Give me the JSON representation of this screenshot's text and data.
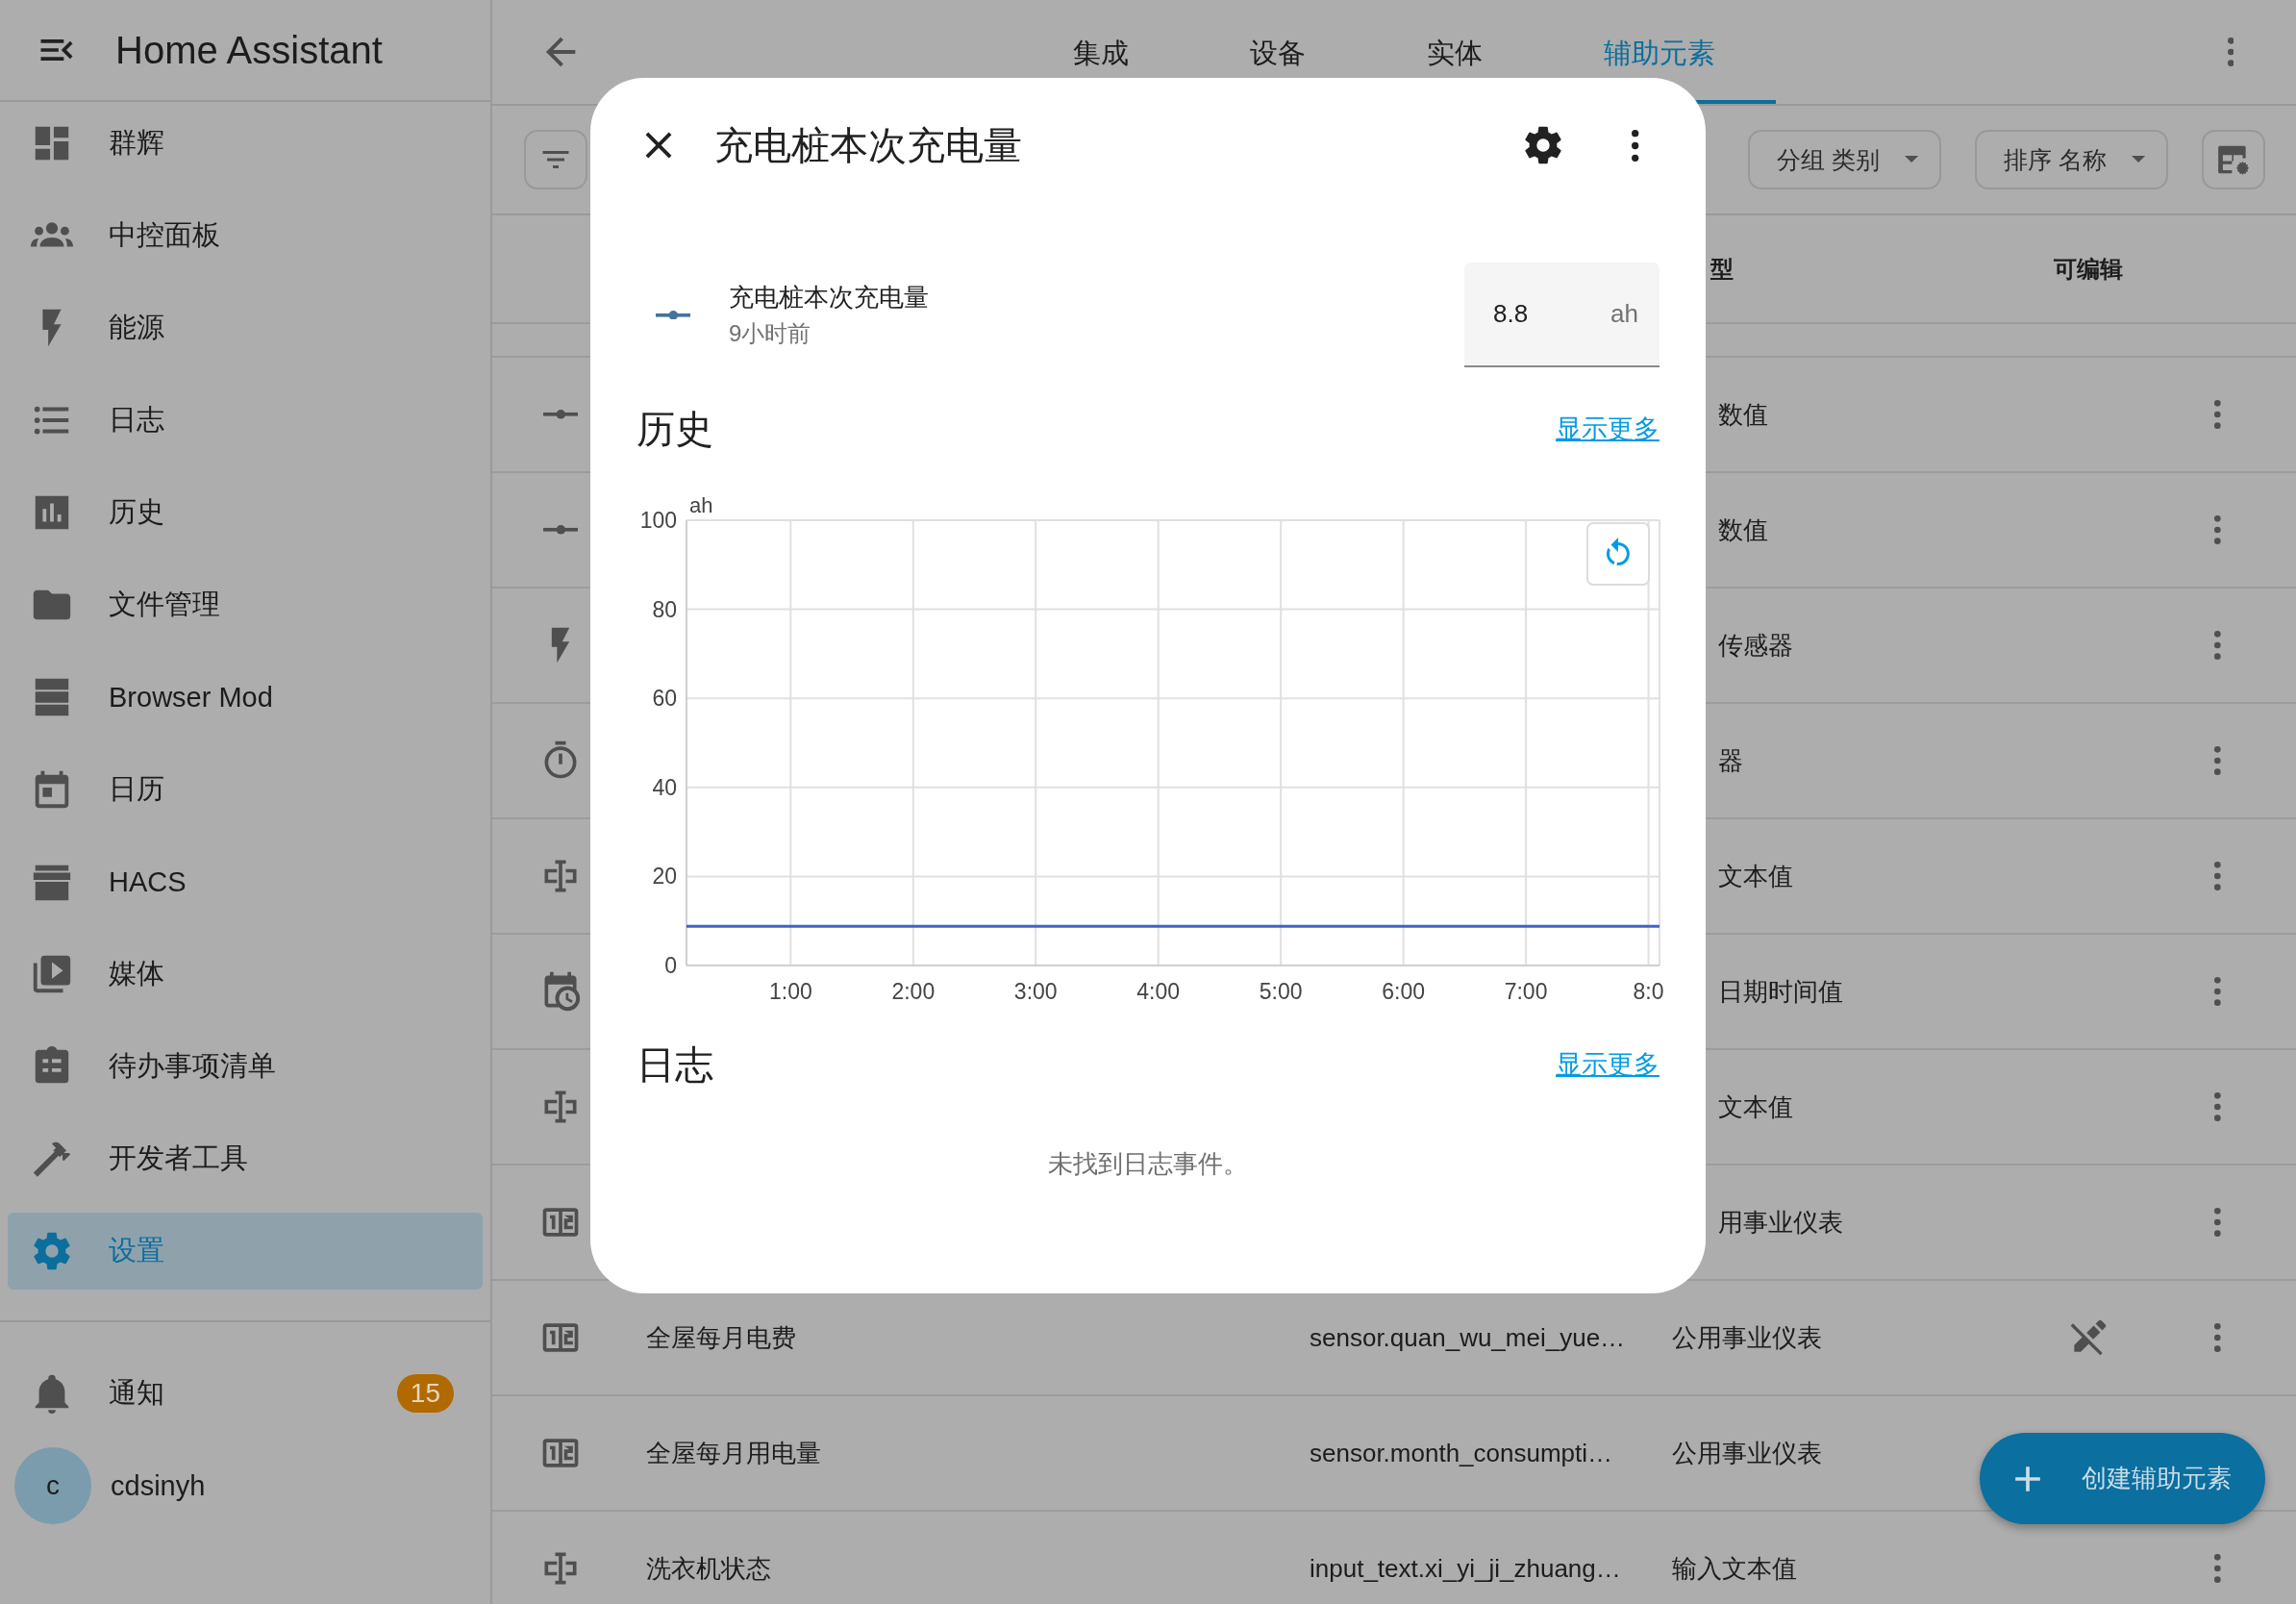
{
  "sidebar": {
    "title": "Home Assistant",
    "items": [
      {
        "label": "群辉",
        "selected": false
      },
      {
        "label": "中控面板",
        "selected": false
      },
      {
        "label": "能源",
        "selected": false
      },
      {
        "label": "日志",
        "selected": false
      },
      {
        "label": "历史",
        "selected": false
      },
      {
        "label": "文件管理",
        "selected": false
      },
      {
        "label": "Browser Mod",
        "selected": false
      },
      {
        "label": "日历",
        "selected": false
      },
      {
        "label": "HACS",
        "selected": false
      },
      {
        "label": "媒体",
        "selected": false
      },
      {
        "label": "待办事项清单",
        "selected": false
      },
      {
        "label": "开发者工具",
        "selected": false
      },
      {
        "label": "设置",
        "selected": true
      }
    ],
    "notifications": {
      "label": "通知",
      "count": "15"
    },
    "user": {
      "initial": "c",
      "name": "cdsinyh"
    }
  },
  "topbar": {
    "tabs": [
      {
        "label": "集成",
        "selected": false
      },
      {
        "label": "设备",
        "selected": false
      },
      {
        "label": "实体",
        "selected": false
      },
      {
        "label": "辅助元素",
        "selected": true
      }
    ]
  },
  "toolbar": {
    "chips": [
      {
        "label": "分组 类别"
      },
      {
        "label": "排序 名称"
      }
    ]
  },
  "table": {
    "columns": [
      "型",
      "可编辑"
    ],
    "rows": [
      {
        "kind": "slider",
        "type": "数值",
        "read_only": false,
        "menu": true
      },
      {
        "kind": "slider",
        "type": "数值",
        "read_only": false,
        "menu": true
      },
      {
        "kind": "bolt",
        "type": "传感器",
        "read_only": false,
        "menu": true
      },
      {
        "kind": "timer",
        "type": "器",
        "read_only": false,
        "menu": true
      },
      {
        "kind": "text",
        "type": "文本值",
        "read_only": false,
        "menu": true
      },
      {
        "kind": "calendar",
        "type": "日期时间值",
        "read_only": false,
        "menu": true
      },
      {
        "kind": "text",
        "type": "文本值",
        "read_only": false,
        "menu": true
      },
      {
        "kind": "meter",
        "type": "用事业仪表",
        "read_only": false,
        "menu": true
      },
      {
        "kind": "meter",
        "name": "全屋每月电费",
        "entity_id": "sensor.quan_wu_mei_yue…",
        "type": "公用事业仪表",
        "read_only": true,
        "menu": true
      },
      {
        "kind": "meter",
        "name": "全屋每月用电量",
        "entity_id": "sensor.month_consumpti…",
        "type": "公用事业仪表",
        "read_only": false,
        "menu": false
      },
      {
        "kind": "text",
        "name": "洗衣机状态",
        "entity_id": "input_text.xi_yi_ji_zhuang…",
        "type": "输入文本值",
        "read_only": false,
        "menu": true
      }
    ]
  },
  "dialog": {
    "title": "充电桩本次充电量",
    "entity": {
      "name": "充电桩本次充电量",
      "updated": "9小时前",
      "value": "8.8",
      "unit": "ah"
    },
    "history": {
      "heading": "历史",
      "link": "显示更多",
      "chart_data": {
        "type": "line",
        "grid": true,
        "ylabel": "ah",
        "x": [
          0.15,
          8.09
        ],
        "series": [
          {
            "color": "#3f63c7",
            "values": [
              8.8,
              8.8
            ]
          }
        ],
        "xlim": [
          0.15,
          8.09
        ],
        "ylim": [
          0,
          100
        ],
        "xticks": [
          {
            "value": 1,
            "label": "1:00"
          },
          {
            "value": 2,
            "label": "2:00"
          },
          {
            "value": 3,
            "label": "3:00"
          },
          {
            "value": 4,
            "label": "4:00"
          },
          {
            "value": 5,
            "label": "5:00"
          },
          {
            "value": 6,
            "label": "6:00"
          },
          {
            "value": 7,
            "label": "7:00"
          },
          {
            "value": 8,
            "label": "8:0"
          }
        ],
        "yticks": [
          0,
          20,
          40,
          60,
          80,
          100
        ]
      }
    },
    "logbook": {
      "heading": "日志",
      "link": "显示更多",
      "empty": "未找到日志事件。"
    }
  },
  "fab": {
    "label": "创建辅助元素"
  }
}
